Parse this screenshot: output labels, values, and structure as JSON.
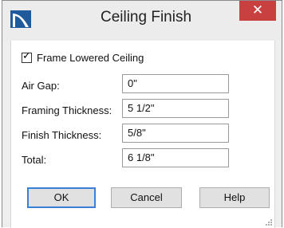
{
  "window": {
    "title": "Ceiling Finish",
    "close_glyph": "✕"
  },
  "checkbox": {
    "label": "Frame Lowered Ceiling",
    "checked": true
  },
  "fields": [
    {
      "label": "Air Gap:",
      "value": "0\""
    },
    {
      "label": "Framing Thickness:",
      "value": "5 1/2\""
    },
    {
      "label": "Finish Thickness:",
      "value": "5/8\""
    },
    {
      "label": "Total:",
      "value": "6 1/8\""
    }
  ],
  "buttons": {
    "ok": "OK",
    "cancel": "Cancel",
    "help": "Help"
  },
  "colors": {
    "close_button": "#c84040",
    "default_button_border": "#3c7fd8",
    "app_icon": "#1f5a9c"
  }
}
